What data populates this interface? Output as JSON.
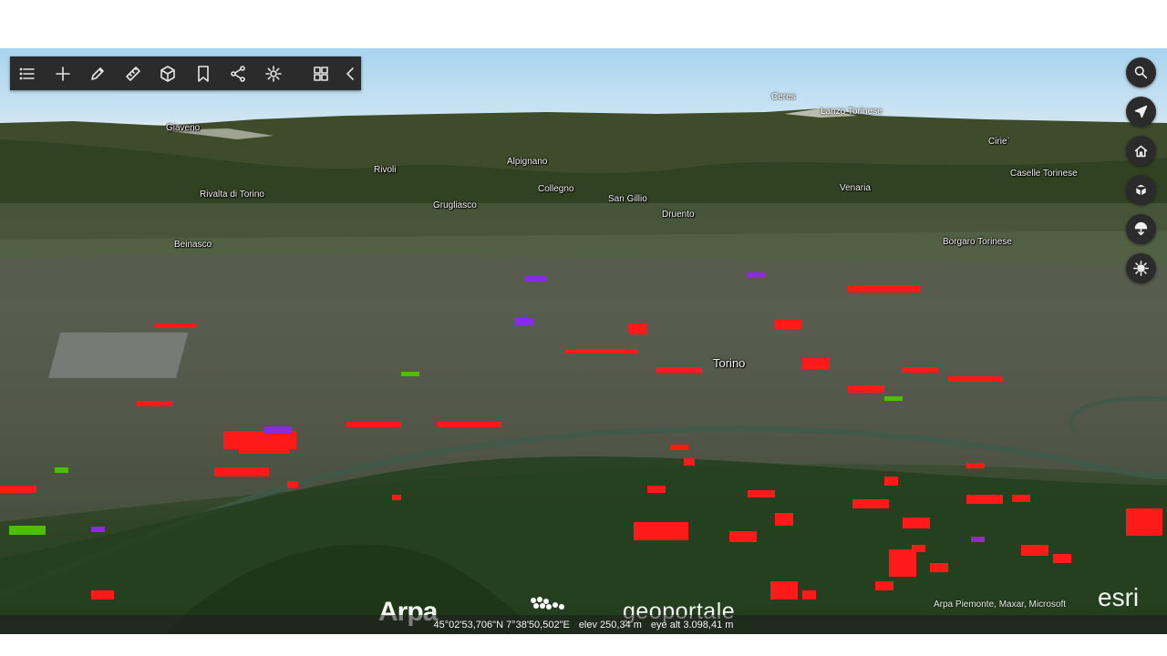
{
  "toolbar": {
    "items": [
      {
        "name": "list-icon"
      },
      {
        "name": "plus-icon"
      },
      {
        "name": "pencil-icon"
      },
      {
        "name": "ruler-icon"
      },
      {
        "name": "cube-slice-icon"
      },
      {
        "name": "bookmark-icon"
      },
      {
        "name": "share-icon"
      },
      {
        "name": "gear-icon"
      },
      {
        "name": "grid-icon"
      },
      {
        "name": "chevron-left-icon"
      }
    ]
  },
  "right_tools": [
    {
      "name": "search-icon"
    },
    {
      "name": "navigate-icon"
    },
    {
      "name": "home-icon"
    },
    {
      "name": "cube-icon"
    },
    {
      "name": "download-icon"
    },
    {
      "name": "sun-icon"
    }
  ],
  "places": {
    "ceres": "Ceres",
    "lanzo": "Lanzo Torinese",
    "cirie": "Cirie`",
    "giaveno": "Giaveno",
    "caselle": "Caselle Torinese",
    "rivoli": "Rivoli",
    "alpignano": "Alpignano",
    "collegno": "Collegno",
    "venaria": "Venaria",
    "san_gillio": "San Gillio",
    "rivalta": "Rivalta di Torino",
    "grugliasco": "Grugliasco",
    "druento": "Druento",
    "beinasco": "Beinasco",
    "borgaro": "Borgaro Torinese",
    "torino": "Torino"
  },
  "status": {
    "coordinates": "45°02'53,706\"N 7°38'50,502\"E",
    "elevation": "elev 250,34 m",
    "eye_altitude": "eye alt 3.098,41 m"
  },
  "attribution": "Arpa Piemonte, Maxar, Microsoft",
  "logos": {
    "arpa": "Arpa",
    "geoportale": "geoportale",
    "esri": "esri"
  },
  "colors": {
    "toolbar_bg": "#2b2b2b",
    "hotspot_red": "#ff1a1a",
    "hotspot_purple": "#8a2be2",
    "hotspot_green": "#4cc000"
  }
}
